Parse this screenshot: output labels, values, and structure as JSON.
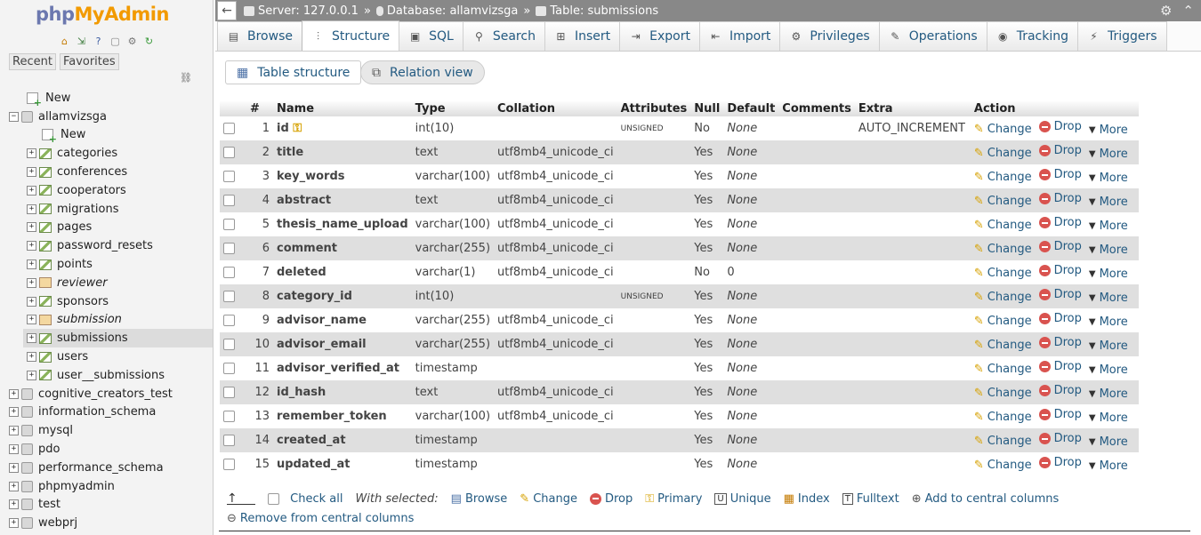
{
  "sidebar": {
    "logo_php": "php",
    "logo_ma": "MyAdmin",
    "recent": "Recent",
    "favorites": "Favorites",
    "tree": [
      {
        "label": "New",
        "level": 1,
        "type": "new"
      },
      {
        "label": "allamvizsga",
        "level": 0,
        "type": "db",
        "expanded": true
      },
      {
        "label": "New",
        "level": 2,
        "type": "new"
      },
      {
        "label": "categories",
        "level": 2,
        "type": "table"
      },
      {
        "label": "conferences",
        "level": 2,
        "type": "table"
      },
      {
        "label": "cooperators",
        "level": 2,
        "type": "table"
      },
      {
        "label": "migrations",
        "level": 2,
        "type": "table"
      },
      {
        "label": "pages",
        "level": 2,
        "type": "table"
      },
      {
        "label": "password_resets",
        "level": 2,
        "type": "table"
      },
      {
        "label": "points",
        "level": 2,
        "type": "table"
      },
      {
        "label": "reviewer",
        "level": 2,
        "type": "view"
      },
      {
        "label": "sponsors",
        "level": 2,
        "type": "table"
      },
      {
        "label": "submission",
        "level": 2,
        "type": "view"
      },
      {
        "label": "submissions",
        "level": 2,
        "type": "table",
        "selected": true
      },
      {
        "label": "users",
        "level": 2,
        "type": "table"
      },
      {
        "label": "user__submissions",
        "level": 2,
        "type": "table"
      },
      {
        "label": "cognitive_creators_test",
        "level": 0,
        "type": "db"
      },
      {
        "label": "information_schema",
        "level": 0,
        "type": "db"
      },
      {
        "label": "mysql",
        "level": 0,
        "type": "db"
      },
      {
        "label": "pdo",
        "level": 0,
        "type": "db"
      },
      {
        "label": "performance_schema",
        "level": 0,
        "type": "db"
      },
      {
        "label": "phpmyadmin",
        "level": 0,
        "type": "db"
      },
      {
        "label": "test",
        "level": 0,
        "type": "db"
      },
      {
        "label": "webprj",
        "level": 0,
        "type": "db"
      }
    ]
  },
  "breadcrumb": {
    "server": "Server: 127.0.0.1",
    "database": "Database: allamvizsga",
    "table": "Table: submissions",
    "sep": "»"
  },
  "tabs": [
    {
      "label": "Browse",
      "icon": "browse-icon",
      "glyph": "▤"
    },
    {
      "label": "Structure",
      "icon": "structure-icon",
      "glyph": "⫶",
      "active": true
    },
    {
      "label": "SQL",
      "icon": "sql-icon",
      "glyph": "▣"
    },
    {
      "label": "Search",
      "icon": "search-icon",
      "glyph": "⚲"
    },
    {
      "label": "Insert",
      "icon": "insert-icon",
      "glyph": "⊞"
    },
    {
      "label": "Export",
      "icon": "export-icon",
      "glyph": "⇥"
    },
    {
      "label": "Import",
      "icon": "import-icon",
      "glyph": "⇤"
    },
    {
      "label": "Privileges",
      "icon": "privileges-icon",
      "glyph": "⚙"
    },
    {
      "label": "Operations",
      "icon": "operations-icon",
      "glyph": "✎"
    },
    {
      "label": "Tracking",
      "icon": "tracking-icon",
      "glyph": "◉"
    },
    {
      "label": "Triggers",
      "icon": "triggers-icon",
      "glyph": "⚡"
    }
  ],
  "subtabs": {
    "table_structure": "Table structure",
    "relation_view": "Relation view"
  },
  "table": {
    "headers": [
      "#",
      "Name",
      "Type",
      "Collation",
      "Attributes",
      "Null",
      "Default",
      "Comments",
      "Extra",
      "Action"
    ],
    "rows": [
      {
        "n": "1",
        "name": "id",
        "key": true,
        "type": "int(10)",
        "collation": "",
        "attributes": "UNSIGNED",
        "null": "No",
        "default": "None",
        "comments": "",
        "extra": "AUTO_INCREMENT"
      },
      {
        "n": "2",
        "name": "title",
        "type": "text",
        "collation": "utf8mb4_unicode_ci",
        "attributes": "",
        "null": "Yes",
        "default": "None",
        "comments": "",
        "extra": ""
      },
      {
        "n": "3",
        "name": "key_words",
        "type": "varchar(100)",
        "collation": "utf8mb4_unicode_ci",
        "attributes": "",
        "null": "Yes",
        "default": "None",
        "comments": "",
        "extra": ""
      },
      {
        "n": "4",
        "name": "abstract",
        "type": "text",
        "collation": "utf8mb4_unicode_ci",
        "attributes": "",
        "null": "Yes",
        "default": "None",
        "comments": "",
        "extra": ""
      },
      {
        "n": "5",
        "name": "thesis_name_upload",
        "type": "varchar(100)",
        "collation": "utf8mb4_unicode_ci",
        "attributes": "",
        "null": "Yes",
        "default": "None",
        "comments": "",
        "extra": ""
      },
      {
        "n": "6",
        "name": "comment",
        "type": "varchar(255)",
        "collation": "utf8mb4_unicode_ci",
        "attributes": "",
        "null": "Yes",
        "default": "None",
        "comments": "",
        "extra": ""
      },
      {
        "n": "7",
        "name": "deleted",
        "type": "varchar(1)",
        "collation": "utf8mb4_unicode_ci",
        "attributes": "",
        "null": "No",
        "default": "0",
        "comments": "",
        "extra": ""
      },
      {
        "n": "8",
        "name": "category_id",
        "type": "int(10)",
        "collation": "",
        "attributes": "UNSIGNED",
        "null": "Yes",
        "default": "None",
        "comments": "",
        "extra": ""
      },
      {
        "n": "9",
        "name": "advisor_name",
        "type": "varchar(255)",
        "collation": "utf8mb4_unicode_ci",
        "attributes": "",
        "null": "Yes",
        "default": "None",
        "comments": "",
        "extra": ""
      },
      {
        "n": "10",
        "name": "advisor_email",
        "type": "varchar(255)",
        "collation": "utf8mb4_unicode_ci",
        "attributes": "",
        "null": "Yes",
        "default": "None",
        "comments": "",
        "extra": ""
      },
      {
        "n": "11",
        "name": "advisor_verified_at",
        "type": "timestamp",
        "collation": "",
        "attributes": "",
        "null": "Yes",
        "default": "None",
        "comments": "",
        "extra": ""
      },
      {
        "n": "12",
        "name": "id_hash",
        "type": "text",
        "collation": "utf8mb4_unicode_ci",
        "attributes": "",
        "null": "Yes",
        "default": "None",
        "comments": "",
        "extra": ""
      },
      {
        "n": "13",
        "name": "remember_token",
        "type": "varchar(100)",
        "collation": "utf8mb4_unicode_ci",
        "attributes": "",
        "null": "Yes",
        "default": "None",
        "comments": "",
        "extra": ""
      },
      {
        "n": "14",
        "name": "created_at",
        "type": "timestamp",
        "collation": "",
        "attributes": "",
        "null": "Yes",
        "default": "None",
        "comments": "",
        "extra": ""
      },
      {
        "n": "15",
        "name": "updated_at",
        "type": "timestamp",
        "collation": "",
        "attributes": "",
        "null": "Yes",
        "default": "None",
        "comments": "",
        "extra": ""
      }
    ],
    "actions": {
      "change": "Change",
      "drop": "Drop",
      "more": "More"
    }
  },
  "footer": {
    "check_all": "Check all",
    "with_selected": "With selected:",
    "browse": "Browse",
    "change": "Change",
    "drop": "Drop",
    "primary": "Primary",
    "unique": "Unique",
    "index": "Index",
    "fulltext": "Fulltext",
    "add_central": "Add to central columns",
    "remove_central": "Remove from central columns"
  }
}
